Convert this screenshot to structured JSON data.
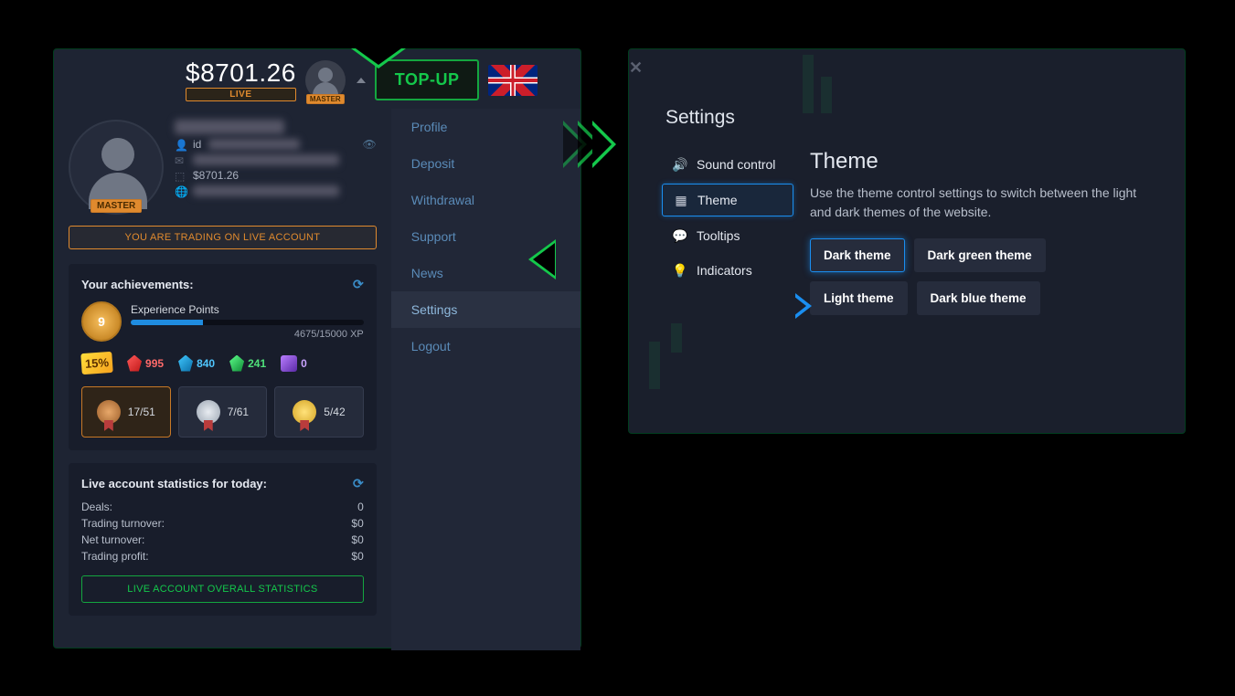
{
  "header": {
    "balance": "$8701.26",
    "account_type": "LIVE",
    "avatar_badge": "MASTER",
    "topup_label": "TOP-UP"
  },
  "profile": {
    "avatar_badge": "MASTER",
    "id_prefix": "id",
    "balance": "$8701.26",
    "live_banner": "YOU ARE TRADING ON LIVE ACCOUNT"
  },
  "achievements": {
    "title": "Your achievements:",
    "level": "9",
    "xp_label": "Experience Points",
    "xp_text": "4675/15000 XP",
    "bonus": "15%",
    "gems": {
      "red": "995",
      "blue": "840",
      "green": "241",
      "purple": "0"
    },
    "medals": {
      "bronze": "17/51",
      "silver": "7/61",
      "gold": "5/42"
    }
  },
  "stats": {
    "title": "Live account statistics for today:",
    "rows": [
      {
        "label": "Deals:",
        "value": "0"
      },
      {
        "label": "Trading turnover:",
        "value": "$0"
      },
      {
        "label": "Net turnover:",
        "value": "$0"
      },
      {
        "label": "Trading profit:",
        "value": "$0"
      }
    ],
    "button": "LIVE ACCOUNT OVERALL STATISTICS"
  },
  "nav": {
    "profile": "Profile",
    "deposit": "Deposit",
    "withdrawal": "Withdrawal",
    "support": "Support",
    "news": "News",
    "settings": "Settings",
    "logout": "Logout"
  },
  "settings_panel": {
    "title": "Settings",
    "nav": {
      "sound": "Sound control",
      "theme": "Theme",
      "tooltips": "Tooltips",
      "indicators": "Indicators"
    },
    "content": {
      "title": "Theme",
      "desc": "Use the theme control settings to switch between the light and dark themes of the website.",
      "opts": {
        "dark": "Dark theme",
        "dark_green": "Dark green theme",
        "light": "Light theme",
        "dark_blue": "Dark blue theme"
      }
    }
  }
}
